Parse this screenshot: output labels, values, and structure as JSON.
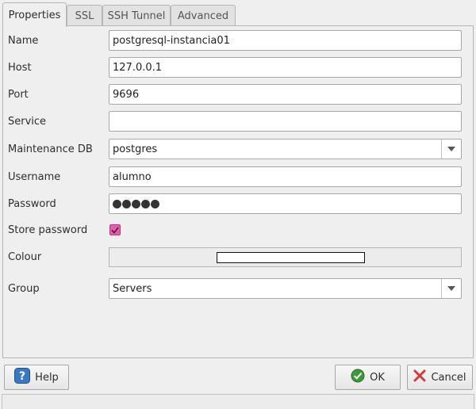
{
  "tabs": [
    {
      "label": "Properties",
      "active": true
    },
    {
      "label": "SSL",
      "active": false
    },
    {
      "label": "SSH Tunnel",
      "active": false
    },
    {
      "label": "Advanced",
      "active": false
    }
  ],
  "form": {
    "name": {
      "label": "Name",
      "value": "postgresql-instancia01"
    },
    "host": {
      "label": "Host",
      "value": "127.0.0.1"
    },
    "port": {
      "label": "Port",
      "value": "9696"
    },
    "service": {
      "label": "Service",
      "value": ""
    },
    "maintenance_db": {
      "label": "Maintenance DB",
      "value": "postgres"
    },
    "username": {
      "label": "Username",
      "value": "alumno"
    },
    "password": {
      "label": "Password",
      "masked_length": 5
    },
    "store_password": {
      "label": "Store password",
      "checked": true
    },
    "colour": {
      "label": "Colour",
      "value_color": "#ffffff"
    },
    "group": {
      "label": "Group",
      "value": "Servers"
    }
  },
  "buttons": {
    "help": "Help",
    "ok": "OK",
    "cancel": "Cancel"
  },
  "icons": {
    "help": "question-mark-icon",
    "ok": "check-circle-icon",
    "cancel": "x-mark-icon",
    "combo": "chevron-down-icon"
  },
  "colors": {
    "checkbox_accent": "#e95aa8",
    "help_icon": "#3a78c2",
    "ok_icon": "#3c9a3c",
    "cancel_icon": "#d23c3c"
  }
}
